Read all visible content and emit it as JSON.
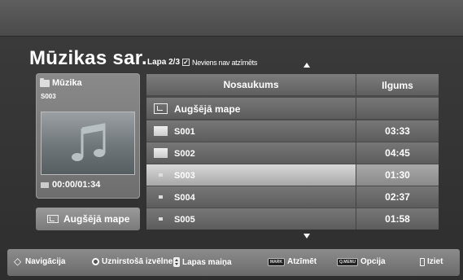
{
  "title": "Mūzikas sar.",
  "page": {
    "label": "Lapa 2/3",
    "mark_status": "Neviens nav atzīmēts"
  },
  "preview": {
    "folder_label": "Mūzika",
    "file": "S003",
    "time": "00:00/01:34"
  },
  "up_button": {
    "label": "Augšējā mape"
  },
  "columns": {
    "name": "Nosaukums",
    "duration": "Ilgums"
  },
  "rows": [
    {
      "name": "Augšējā mape",
      "duration": "",
      "type": "up-folder",
      "selected": false
    },
    {
      "name": "S001",
      "duration": "03:33",
      "type": "folder",
      "selected": false
    },
    {
      "name": "S002",
      "duration": "04:45",
      "type": "folder",
      "selected": false
    },
    {
      "name": "S003",
      "duration": "01:30",
      "type": "file",
      "selected": true
    },
    {
      "name": "S004",
      "duration": "02:37",
      "type": "file",
      "selected": false
    },
    {
      "name": "S005",
      "duration": "01:58",
      "type": "file",
      "selected": false
    }
  ],
  "footer": {
    "navigation": "Navigācija",
    "popup_menu": "Uznirstošā izvēlne",
    "page_change": "Lapas maiņa",
    "mark_key": "MARK",
    "mark": "Atzīmēt",
    "menu_key": "Q.MENU",
    "option": "Opcija",
    "exit": "Iziet"
  },
  "colors": {
    "selected_row": "#c8c8c8",
    "background": "#2e2e2e"
  }
}
